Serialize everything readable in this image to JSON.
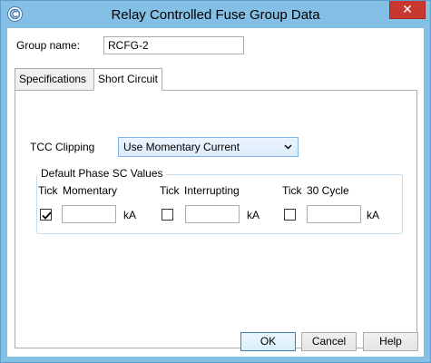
{
  "window": {
    "title": "Relay Controlled Fuse Group Data",
    "close_label": "✕"
  },
  "group_name": {
    "label": "Group name:",
    "value": "RCFG-2"
  },
  "tabs": [
    {
      "label": "Specifications",
      "active": false
    },
    {
      "label": "Short Circuit",
      "active": true
    }
  ],
  "tcc_clipping": {
    "label": "TCC Clipping",
    "selected": "Use Momentary Current"
  },
  "phase_sc": {
    "legend": "Default Phase SC Values",
    "columns": [
      {
        "tick_label": "Tick",
        "name": "Momentary",
        "checked": true,
        "value": "",
        "unit": "kA"
      },
      {
        "tick_label": "Tick",
        "name": "Interrupting",
        "checked": false,
        "value": "",
        "unit": "kA"
      },
      {
        "tick_label": "Tick",
        "name": "30 Cycle",
        "checked": false,
        "value": "",
        "unit": "kA"
      }
    ]
  },
  "buttons": {
    "ok": "OK",
    "cancel": "Cancel",
    "help": "Help"
  }
}
